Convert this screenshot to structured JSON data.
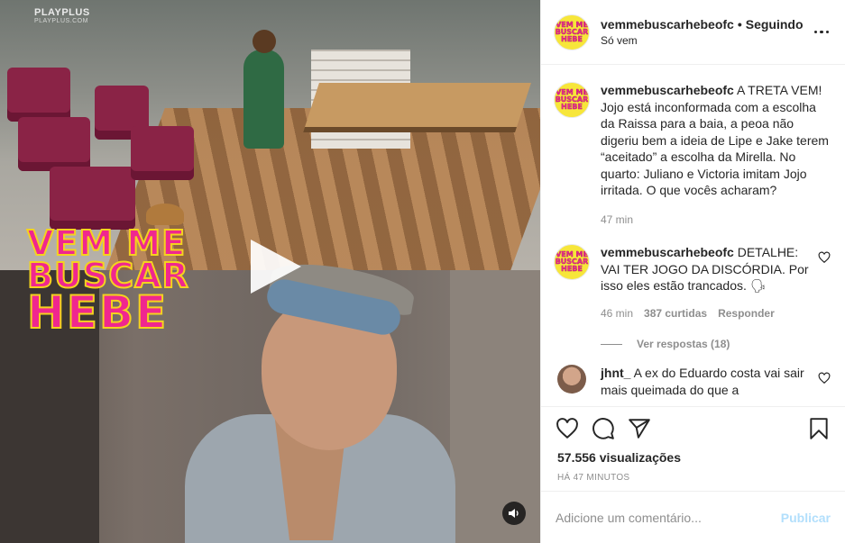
{
  "media": {
    "watermark_top": "PLAYPLUS",
    "watermark_sub": "PLAYPLUS.COM",
    "overlay_logo": {
      "line1": "VEM ME",
      "line2": "BUSCAR",
      "line3": "HEBE"
    },
    "play_icon": "play-icon",
    "sound_icon": "speaker-icon"
  },
  "header": {
    "username": "vemmebuscarhebeofc",
    "separator": "•",
    "follow_state": "Seguindo",
    "subtitle": "Só vem",
    "avatar_text": [
      "VEM ME",
      "BUSCAR",
      "HEBE"
    ],
    "more_icon": "more-horizontal-icon"
  },
  "caption": {
    "username": "vemmebuscarhebeofc",
    "text": "A TRETA VEM! Jojo está inconformada com a escolha da Raissa para a baia, a peoa não digeriu bem a ideia de Lipe e Jake terem “aceitado” a escolha da Mirella. No quarto: Juliano e Victoria imitam Jojo irritada. O que vocês acharam?",
    "time": "47 min"
  },
  "comments": [
    {
      "username": "vemmebuscarhebeofc",
      "text": "DETALHE: VAI TER JOGO DA DISCÓRDIA. Por isso eles estão trancados. 🗣",
      "time": "46 min",
      "likes": "387 curtidas",
      "reply": "Responder",
      "view_replies": "Ver respostas (18)"
    },
    {
      "username": "jhnt_",
      "text": "A ex do Eduardo costa vai sair mais queimada do que a"
    }
  ],
  "actions": {
    "icons": [
      "heart-icon",
      "comment-icon",
      "share-icon",
      "bookmark-icon"
    ],
    "views": "57.556 visualizações",
    "posted_ago": "HÁ 47 MINUTOS"
  },
  "add_comment": {
    "placeholder": "Adicione um comentário...",
    "publish_label": "Publicar"
  },
  "colors": {
    "brand_pink": "#f0278f",
    "brand_yellow": "#f4d21f",
    "publish_disabled": "#b2dffc",
    "secondary_text": "#8e8e8e"
  }
}
